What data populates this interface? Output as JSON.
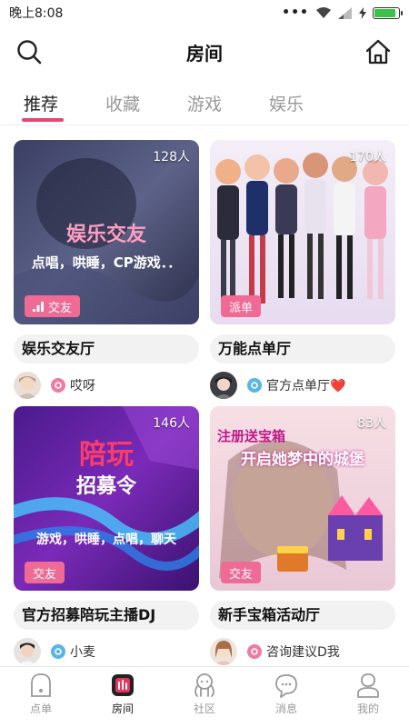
{
  "status": {
    "time": "晚上8:08",
    "battery_level": 0.9
  },
  "header": {
    "title": "房间",
    "left_icon": "search-icon",
    "right_icon": "home-icon"
  },
  "tabs": [
    {
      "label": "推荐",
      "active": true
    },
    {
      "label": "收藏",
      "active": false
    },
    {
      "label": "游戏",
      "active": false
    },
    {
      "label": "娱乐",
      "active": false
    }
  ],
  "rooms": [
    {
      "count": "128人",
      "tag": "交友",
      "tag_icon": "bar-chart-icon",
      "cover_title": "娱乐交友",
      "cover_subtitle": "点唱，哄睡，CP游戏．．",
      "name": "娱乐交友厅",
      "host": "哎呀",
      "host_badge_color": "#f07aa3"
    },
    {
      "count": "170人",
      "tag": "派单",
      "name": "万能点单厅",
      "host": "官方点单厅❤️",
      "host_badge_color": "#5bb4e8"
    },
    {
      "count": "146人",
      "tag": "交友",
      "cover_title": "陪玩",
      "cover_subtitle": "招募令",
      "cover_caption": "游戏，哄睡，点唱，聊天",
      "name": "官方招募陪玩主播DJ",
      "host": "小麦",
      "host_badge_color": "#5bb4e8"
    },
    {
      "count": "83人",
      "tag": "交友",
      "cover_title": "注册送宝箱",
      "cover_subtitle": "开启她梦中的城堡",
      "name": "新手宝箱活动厅",
      "host": "咨询建议D我",
      "host_badge_color": "#f07aa3"
    }
  ],
  "bottom_nav": [
    {
      "label": "点单",
      "icon": "order-icon",
      "active": false
    },
    {
      "label": "房间",
      "icon": "room-icon",
      "active": true
    },
    {
      "label": "社区",
      "icon": "community-icon",
      "active": false
    },
    {
      "label": "消息",
      "icon": "message-icon",
      "active": false
    },
    {
      "label": "我的",
      "icon": "profile-icon",
      "active": false
    }
  ],
  "colors": {
    "accent": "#e8466f",
    "tag": "#f06a96",
    "active_room_icon": "#e8335f"
  }
}
